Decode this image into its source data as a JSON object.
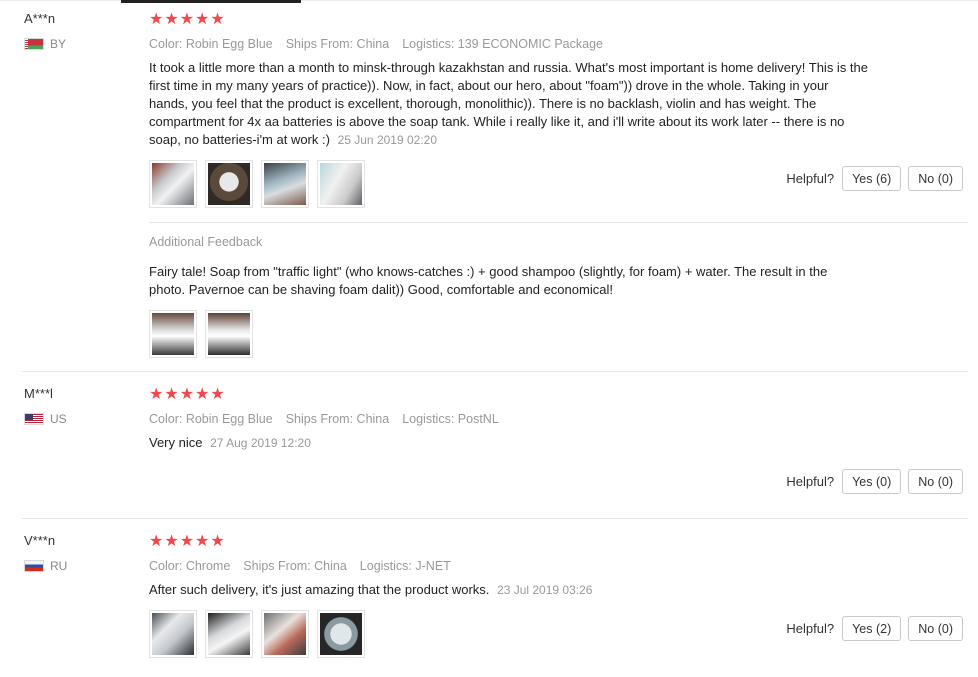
{
  "reviews": [
    {
      "user": "A***n",
      "country": "BY",
      "stars": "★★★★★",
      "meta": {
        "color": "Color: Robin Egg Blue",
        "ships": "Ships From: China",
        "logistics": "Logistics: 139 ECONOMIC Package"
      },
      "text": "It took a little more than a month to minsk-through kazakhstan and russia. What's most important is home delivery! This is the first time in my many years of practice)). Now, in fact, about our hero, about \"foam\")) drove in the whole. Taking in your hands, you feel that the product is excellent, thorough, monolithic)). There is no backlash, violin and has weight. The compartment for 4x aa batteries is above the soap tank. While i really like it, and i'll write about its work later -- there is no soap, no batteries-i'm at work :)",
      "date": "25 Jun 2019 02:20",
      "helpful_label": "Helpful?",
      "yes": "Yes (6)",
      "no": "No (0)",
      "additional": {
        "title": "Additional Feedback",
        "text": "Fairy tale! Soap from \"traffic light\" (who knows-catches :) + good shampoo (slightly, for foam) + water. The result in the photo. Pavernoe can be shaving foam dalit)) Good, comfortable and economical!"
      }
    },
    {
      "user": "M***l",
      "country": "US",
      "stars": "★★★★★",
      "meta": {
        "color": "Color: Robin Egg Blue",
        "ships": "Ships From: China",
        "logistics": "Logistics: PostNL"
      },
      "text": "Very nice",
      "date": "27 Aug 2019 12:20",
      "helpful_label": "Helpful?",
      "yes": "Yes (0)",
      "no": "No (0)"
    },
    {
      "user": "V***n",
      "country": "RU",
      "stars": "★★★★★",
      "meta": {
        "color": "Color: Chrome",
        "ships": "Ships From: China",
        "logistics": "Logistics: J-NET"
      },
      "text": "After such delivery, it's just amazing that the product works.",
      "date": "23 Jul 2019 03:26",
      "helpful_label": "Helpful?",
      "yes": "Yes (2)",
      "no": "No (0)"
    }
  ],
  "colors": {
    "star": "#f0484c",
    "meta_text": "#999999",
    "body_text": "#222222",
    "border": "#e8e8e8"
  }
}
